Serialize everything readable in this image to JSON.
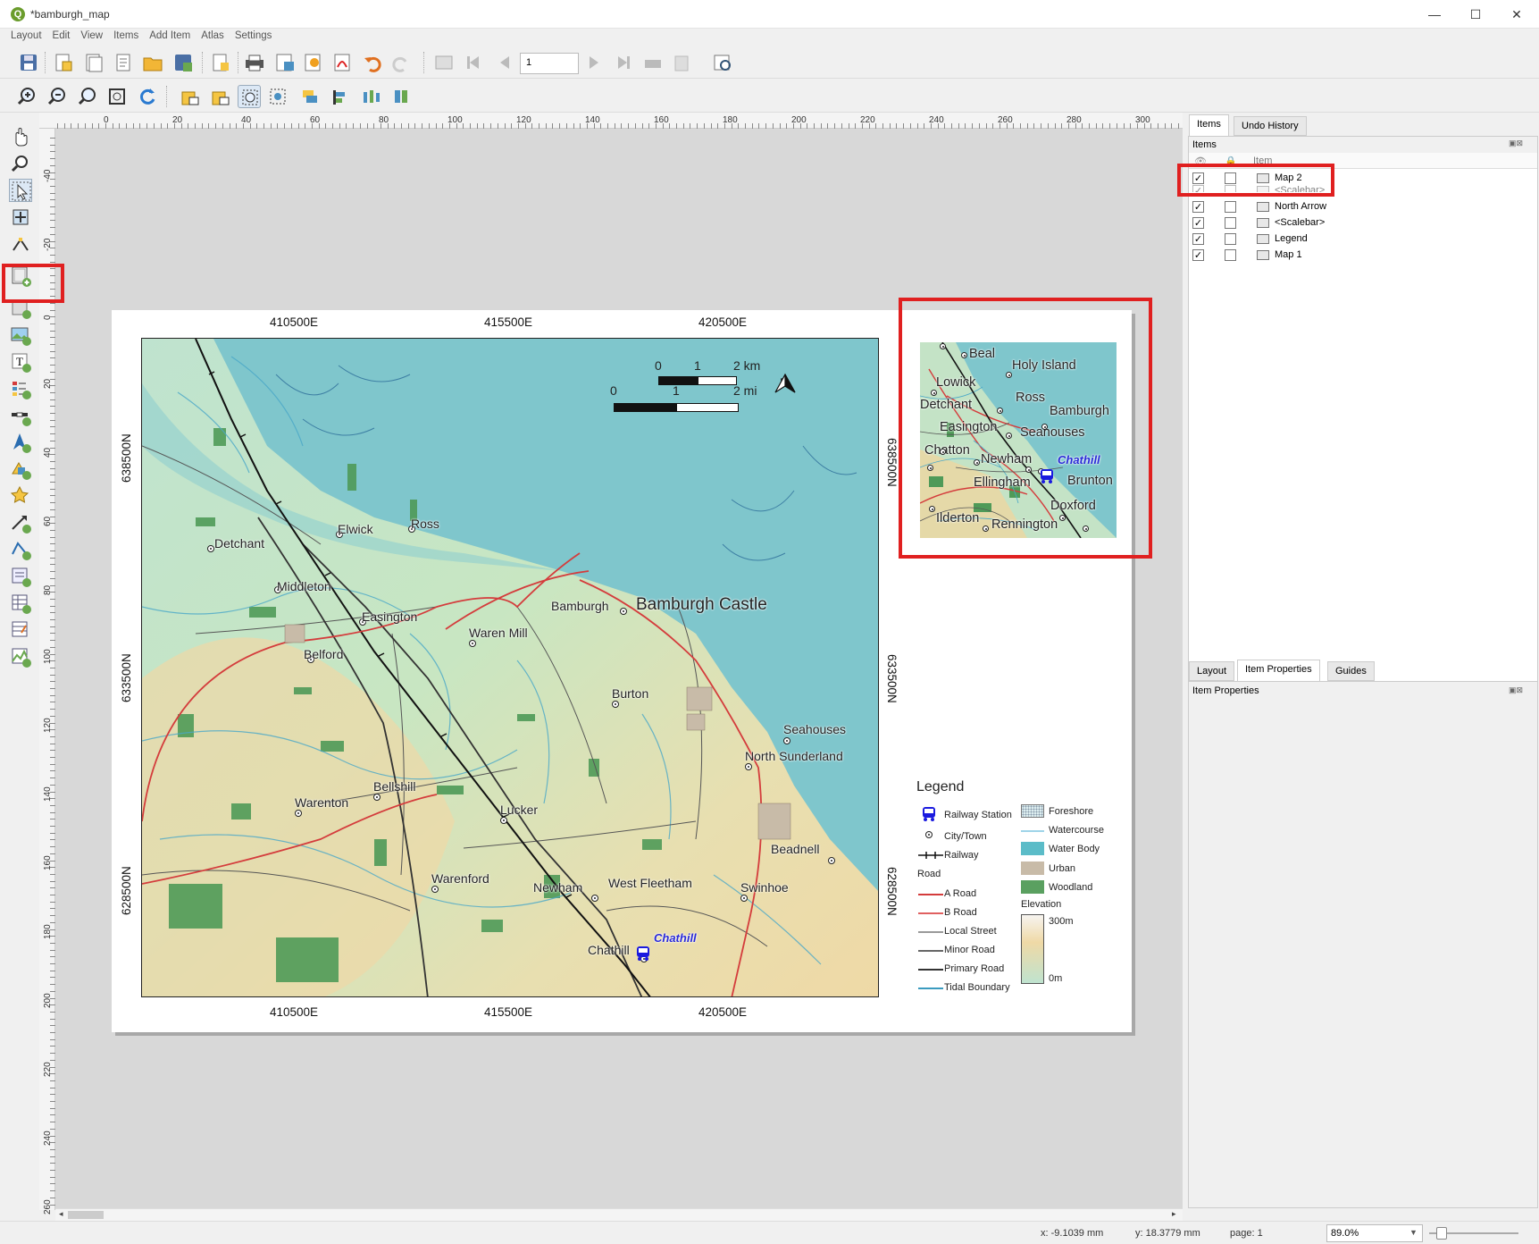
{
  "window": {
    "title": "*bamburgh_map",
    "minimize": "—",
    "maximize": "☐",
    "close": "✕"
  },
  "menu": [
    "Layout",
    "Edit",
    "View",
    "Items",
    "Add Item",
    "Atlas",
    "Settings"
  ],
  "toolbar": {
    "page_number": "1"
  },
  "ruler": {
    "h_ticks": [
      "0",
      "20",
      "40",
      "60",
      "80",
      "100",
      "120",
      "140",
      "160",
      "180",
      "200",
      "220",
      "240",
      "260",
      "280",
      "300"
    ],
    "v_ticks": [
      "-40",
      "-20",
      "0",
      "20",
      "40",
      "60",
      "80",
      "100",
      "120",
      "140",
      "160",
      "180",
      "200",
      "220",
      "240",
      "260"
    ]
  },
  "map1": {
    "top_coords": [
      "410500E",
      "415500E",
      "420500E"
    ],
    "bottom_coords": [
      "410500E",
      "415500E",
      "420500E"
    ],
    "left_coords": [
      "638500N",
      "633500N",
      "628500N"
    ],
    "right_coords": [
      "638500N",
      "633500N",
      "628500N"
    ],
    "places": [
      "Detchant",
      "Elwick",
      "Ross",
      "Middleton",
      "Easington",
      "Belford",
      "Waren Mill",
      "Bamburgh",
      "Bamburgh Castle",
      "Burton",
      "Seahouses",
      "North Sunderland",
      "Bellshill",
      "Warenton",
      "Lucker",
      "Beadnell",
      "Warenford",
      "Newham",
      "West Fleetham",
      "Swinhoe",
      "Chathill"
    ],
    "station_label": "Chathill",
    "scalebar_km": [
      "0",
      "1",
      "2 km"
    ],
    "scalebar_mi": [
      "0",
      "1",
      "2 mi"
    ],
    "north_arrow": "N"
  },
  "map2": {
    "places": [
      "Beal",
      "Holy Island",
      "Lowick",
      "Ross",
      "Detchant",
      "Bamburgh",
      "Easington",
      "Seahouses",
      "Chatton",
      "Newham",
      "Ellingham",
      "Brunton",
      "Doxford",
      "Ilderton",
      "Rennington"
    ],
    "station_label": "Chathill"
  },
  "legend": {
    "title": "Legend",
    "left": [
      "Railway Station",
      "City/Town",
      "Railway"
    ],
    "road_header": "Road",
    "roads": [
      "A Road",
      "B Road",
      "Local Street",
      "Minor Road",
      "Primary Road",
      "Tidal Boundary"
    ],
    "right": [
      "Foreshore",
      "Watercourse",
      "Water Body",
      "Urban",
      "Woodland"
    ],
    "elevation_header": "Elevation",
    "elevation_max": "300m",
    "elevation_min": "0m",
    "colors": {
      "a_road": "#d43c3c",
      "b_road": "#e06060",
      "local": "#999999",
      "minor": "#666666",
      "primary": "#333333",
      "tidal": "#3a9bbf",
      "water_body": "#5bbcc8",
      "urban": "#c8bba8",
      "woodland": "#5aa060",
      "watercourse": "#9fd4e8"
    }
  },
  "panel": {
    "tabs_top": [
      "Items",
      "Undo History"
    ],
    "items_header": "Items",
    "col_item": "Item",
    "items": [
      "Map 2",
      "<Scalebar>",
      "North Arrow",
      "<Scalebar>",
      "Legend",
      "Map 1"
    ],
    "tabs_bottom": [
      "Layout",
      "Item Properties",
      "Guides"
    ],
    "props_header": "Item Properties"
  },
  "status": {
    "x": "x: -9.1039 mm",
    "y": "y: 18.3779 mm",
    "page": "page: 1",
    "zoom": "89.0%"
  }
}
